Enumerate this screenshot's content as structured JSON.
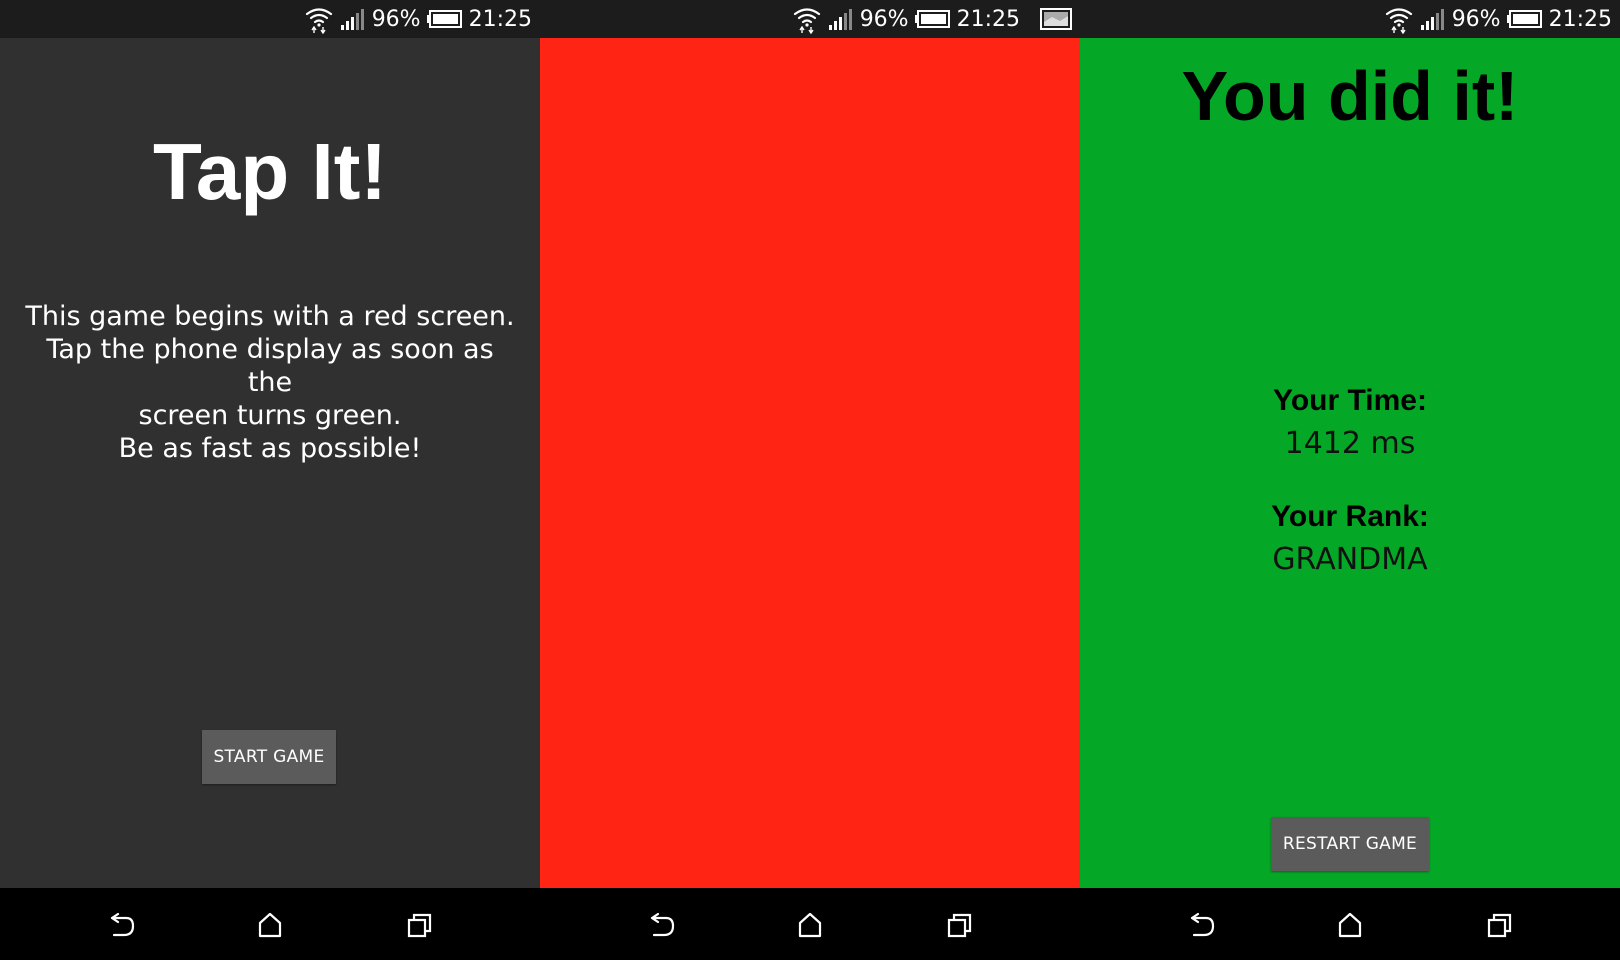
{
  "status_bar": {
    "battery": "96%",
    "time": "21:25"
  },
  "screens": {
    "intro": {
      "title": "Tap It!",
      "instructions": [
        "This game begins with a red screen.",
        "Tap the phone display as soon as the",
        "screen turns green.",
        "Be as fast as possible!"
      ],
      "start_button": "START GAME",
      "background": "#303030"
    },
    "wait": {
      "background": "#ff2414"
    },
    "result": {
      "title": "You did it!",
      "time_label": "Your Time:",
      "time_value": "1412 ms",
      "rank_label": "Your Rank:",
      "rank_value": "GRANDMA",
      "restart_button": "RESTART GAME",
      "background": "#05a826"
    }
  },
  "icons": {
    "status": [
      "wifi-icon",
      "signal-icon",
      "battery-icon"
    ],
    "nav": [
      "back-icon",
      "home-icon",
      "recent-apps-icon"
    ]
  }
}
